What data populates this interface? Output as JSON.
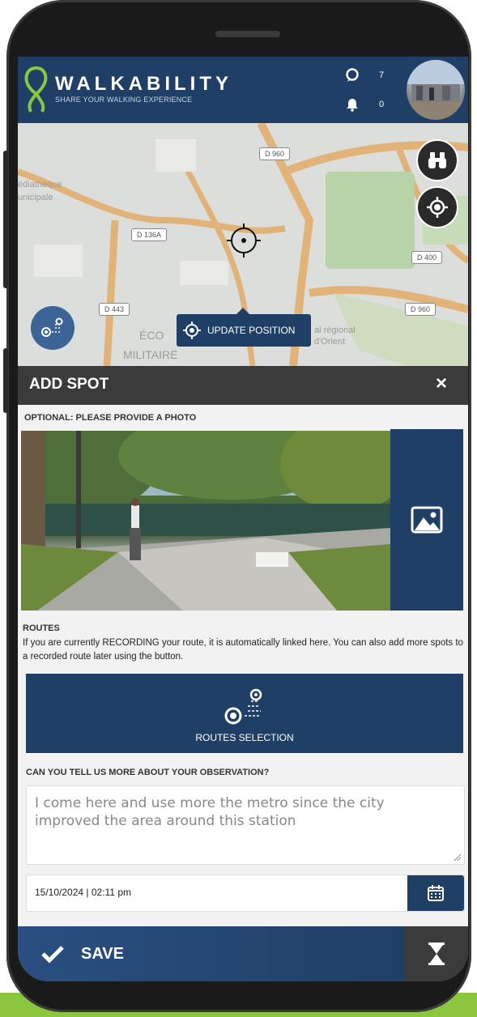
{
  "app": {
    "brand": "WALKABILITY",
    "tagline": "SHARE YOUR WALKING EXPERIENCE"
  },
  "header": {
    "comments_count": "7",
    "notifications_count": "0"
  },
  "map": {
    "road_labels": [
      "D 960",
      "D 136A",
      "D 443",
      "D 400",
      "D 960"
    ],
    "place_labels": [
      "édiathèque",
      "unicipale",
      "ÉCO",
      "MILITAIRE",
      "al régional",
      "d'Orient"
    ],
    "update_position_label": "UPDATE POSITION",
    "icons": [
      "binoculars-icon",
      "locate-icon",
      "crosshair-icon",
      "routes-icon"
    ]
  },
  "panel": {
    "title": "ADD SPOT",
    "close_label": "×",
    "photo_label": "OPTIONAL: PLEASE PROVIDE A PHOTO",
    "routes_title": "ROUTES",
    "routes_description": "If you are currently RECORDING your route, it is automatically linked here. You can also add more spots to a recorded route later using the button.",
    "routes_button_label": "ROUTES SELECTION",
    "observation_label": "CAN YOU TELL US MORE ABOUT YOUR OBSERVATION?",
    "observation_value": "I come here and use more the metro since the city improved the area around this station",
    "datetime_value": "15/10/2024 | 02:11 pm"
  },
  "footer": {
    "save_label": "SAVE"
  },
  "colors": {
    "primary": "#1f3f66",
    "dark_bar": "#3b3b3b",
    "accent_green": "#8cc63f"
  }
}
